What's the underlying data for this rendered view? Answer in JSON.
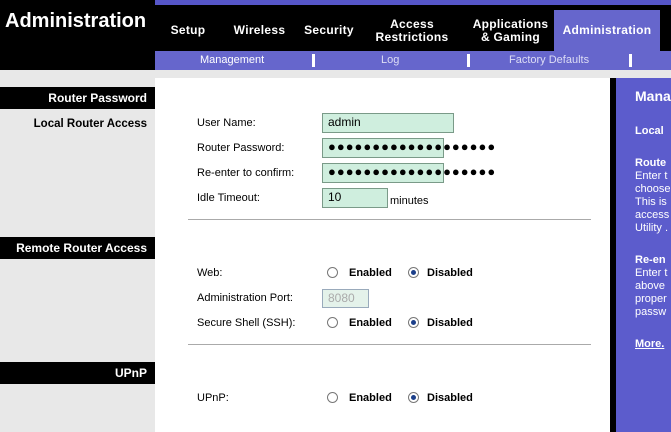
{
  "header": {
    "brand": "Administration",
    "tabs": [
      {
        "l1": "Setup",
        "l2": ""
      },
      {
        "l1": "Wireless",
        "l2": ""
      },
      {
        "l1": "Security",
        "l2": ""
      },
      {
        "l1": "Access",
        "l2": "Restrictions"
      },
      {
        "l1": "Applications",
        "l2": "& Gaming"
      },
      {
        "l1": "Administration",
        "l2": ""
      }
    ],
    "subtabs": [
      "Management",
      "Log",
      "Factory Defaults"
    ]
  },
  "sections": {
    "router_password": "Router Password",
    "local_router_access": "Local Router Access",
    "remote_router_access": "Remote Router Access",
    "upnp": "UPnP"
  },
  "form": {
    "user_name_label": "User Name:",
    "user_name_value": "admin",
    "router_password_label": "Router Password:",
    "router_password_value": "●●●●●●●●●●●●●●●●●●●",
    "reenter_label": "Re-enter to confirm:",
    "reenter_value": "●●●●●●●●●●●●●●●●●●●",
    "idle_timeout_label": "Idle Timeout:",
    "idle_timeout_value": "10",
    "minutes": "minutes",
    "web_label": "Web:",
    "admin_port_label": "Administration Port:",
    "admin_port_value": "8080",
    "ssh_label": "Secure Shell (SSH):",
    "upnp_label": "UPnP:",
    "enabled": "Enabled",
    "disabled": "Disabled"
  },
  "help": {
    "title": "Mana",
    "local": "Local",
    "router_head": "Route",
    "router_lines": [
      "Enter t",
      "choose",
      "This is",
      "access",
      "Utility ."
    ],
    "reenter_head": "Re-en",
    "reenter_lines": [
      "Enter t",
      "above",
      "proper",
      "passw"
    ],
    "more": "More."
  },
  "colors": {
    "accent": "#6666cc",
    "field": "#cfeede",
    "help_bg": "#5c5ccc"
  }
}
